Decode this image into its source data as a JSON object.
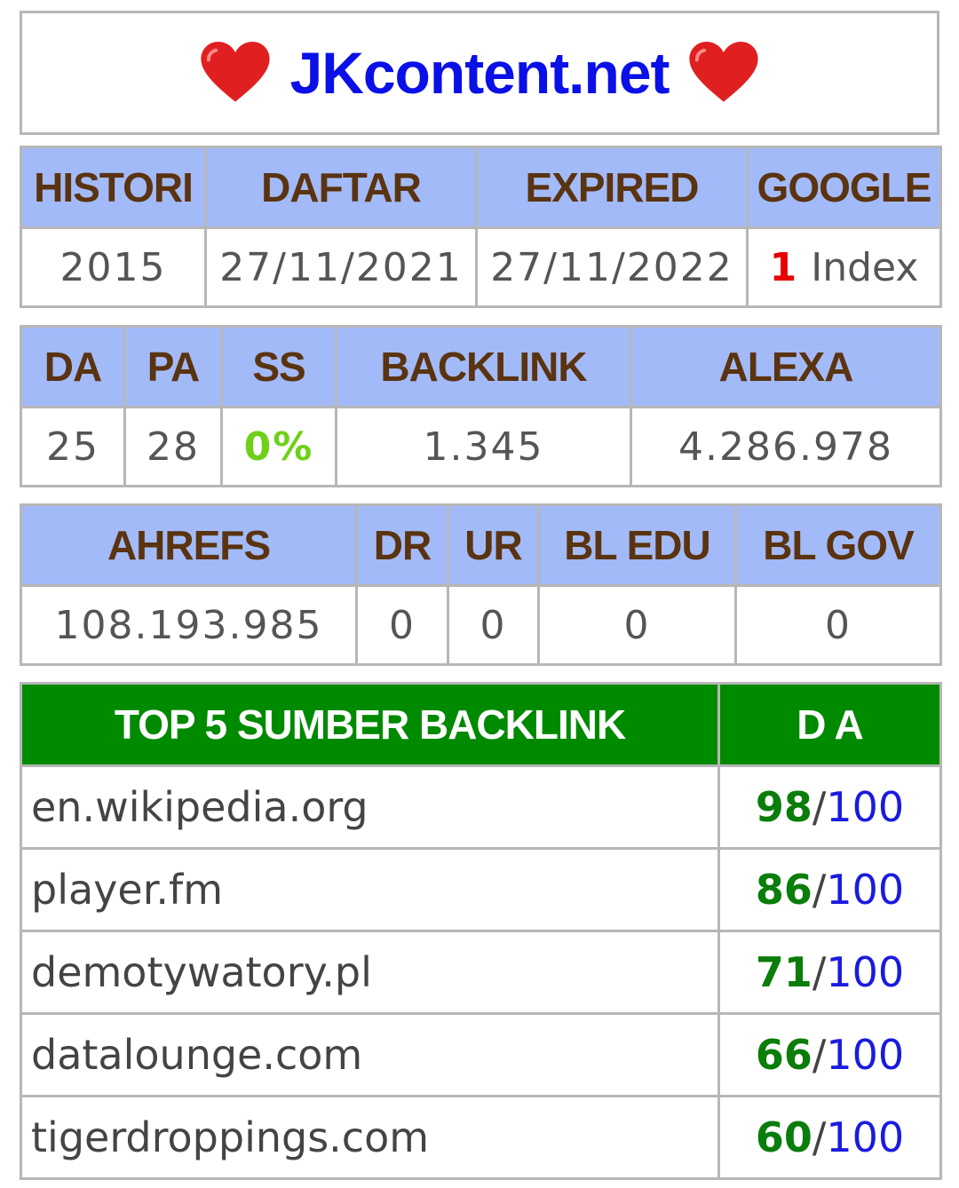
{
  "title": {
    "site": "JKcontent.net",
    "heart_icon": "red-heart-icon",
    "colors": {
      "site": "#0a10e6",
      "heart": "#e02020"
    }
  },
  "table1": {
    "headers": [
      "HISTORI",
      "DAFTAR",
      "EXPIRED",
      "GOOGLE"
    ],
    "values": {
      "histori": "2015",
      "daftar": "27/11/2021",
      "expired": "27/11/2022",
      "google_count": "1",
      "google_label": "Index"
    }
  },
  "table2": {
    "headers": [
      "DA",
      "PA",
      "SS",
      "BACKLINK",
      "ALEXA"
    ],
    "values": {
      "da": "25",
      "pa": "28",
      "ss": "0%",
      "backlink": "1.345",
      "alexa": "4.286.978"
    }
  },
  "table3": {
    "headers": [
      "AHREFS",
      "DR",
      "UR",
      "BL EDU",
      "BL GOV"
    ],
    "values": {
      "ahrefs": "108.193.985",
      "dr": "0",
      "ur": "0",
      "bl_edu": "0",
      "bl_gov": "0"
    }
  },
  "top5": {
    "headers": [
      "TOP 5 SUMBER BACKLINK",
      "D A"
    ],
    "separator": "/",
    "denominator": "100",
    "rows": [
      {
        "domain": "en.wikipedia.org",
        "da": "98"
      },
      {
        "domain": "player.fm",
        "da": "86"
      },
      {
        "domain": "demotywatory.pl",
        "da": "71"
      },
      {
        "domain": "datalounge.com",
        "da": "66"
      },
      {
        "domain": "tigerdroppings.com",
        "da": "60"
      }
    ]
  },
  "colors": {
    "header_bg": "#a3baf8",
    "header_text": "#5a3310",
    "top5_header_bg": "#008a00",
    "ss_green": "#6fd018",
    "google_red": "#e60000",
    "da_green": "#0a7d0a",
    "da_blue": "#1a1ae0"
  }
}
